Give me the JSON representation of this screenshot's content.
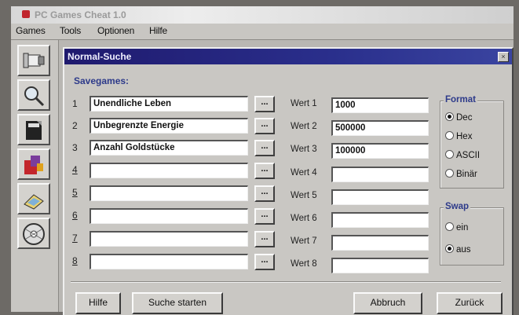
{
  "app": {
    "title": "PC Games Cheat 1.0"
  },
  "menu": [
    "Games",
    "Tools",
    "Optionen",
    "Hilfe"
  ],
  "dialog": {
    "title": "Normal-Suche",
    "close_glyph": "×",
    "section_label": "Savegames:",
    "dots_label": "...",
    "rows": [
      {
        "num": "1",
        "name": "Unendliche Leben",
        "wert_label": "Wert 1",
        "wert_value": "1000"
      },
      {
        "num": "2",
        "name": "Unbegrenzte Energie",
        "wert_label": "Wert 2",
        "wert_value": "500000"
      },
      {
        "num": "3",
        "name": "Anzahl Goldstücke",
        "wert_label": "Wert 3",
        "wert_value": "100000"
      },
      {
        "num": "4",
        "name": "",
        "wert_label": "Wert 4",
        "wert_value": ""
      },
      {
        "num": "5",
        "name": "",
        "wert_label": "Wert 5",
        "wert_value": ""
      },
      {
        "num": "6",
        "name": "",
        "wert_label": "Wert 6",
        "wert_value": ""
      },
      {
        "num": "7",
        "name": "",
        "wert_label": "Wert 7",
        "wert_value": ""
      },
      {
        "num": "8",
        "name": "",
        "wert_label": "Wert 8",
        "wert_value": ""
      }
    ],
    "format": {
      "title": "Format",
      "options": [
        "Dec",
        "Hex",
        "ASCII",
        "Binär"
      ],
      "selected": "Dec"
    },
    "swap": {
      "title": "Swap",
      "options": [
        "ein",
        "aus"
      ],
      "selected": "aus"
    },
    "buttons": {
      "help": "Hilfe",
      "search": "Suche starten",
      "cancel": "Abbruch",
      "back": "Zurück"
    }
  },
  "toolbar_icons": [
    "scroll-icon",
    "magnifier-icon",
    "document-icon",
    "paint-icon",
    "hand-icon",
    "disc-icon"
  ],
  "colors": {
    "dialog_title_bg": "#1f1a6e",
    "group_title": "#2d3a8a",
    "window_bg": "#c9c7c3"
  }
}
